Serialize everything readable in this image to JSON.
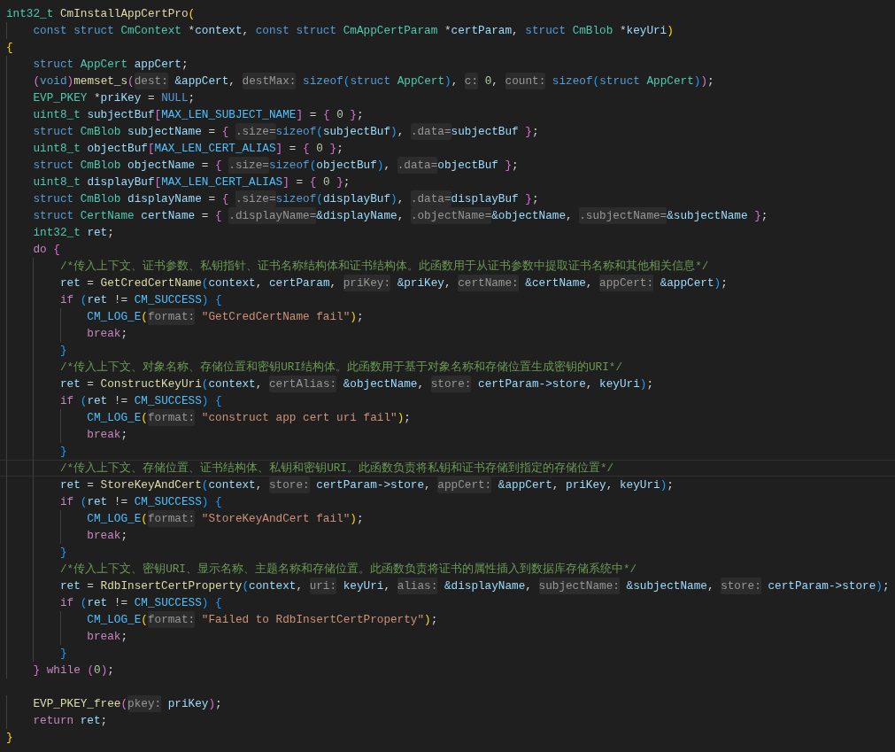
{
  "editor": {
    "lines": [
      {
        "current": false,
        "tokens": [
          {
            "kind": "type",
            "text": "int32_t "
          },
          {
            "kind": "function",
            "text": "CmInstallAppCertPro"
          },
          {
            "kind": "bracket1",
            "text": "("
          }
        ]
      },
      {
        "current": false,
        "tokens": [
          {
            "kind": "keyword",
            "text": "    const struct "
          },
          {
            "kind": "type",
            "text": "CmContext "
          },
          {
            "kind": "punct",
            "text": "*"
          },
          {
            "kind": "variable",
            "text": "context"
          },
          {
            "kind": "punct",
            "text": ", "
          },
          {
            "kind": "keyword",
            "text": "const struct "
          },
          {
            "kind": "type",
            "text": "CmAppCertParam "
          },
          {
            "kind": "punct",
            "text": "*"
          },
          {
            "kind": "variable",
            "text": "certParam"
          },
          {
            "kind": "punct",
            "text": ", "
          },
          {
            "kind": "keyword",
            "text": "struct "
          },
          {
            "kind": "type",
            "text": "CmBlob "
          },
          {
            "kind": "punct",
            "text": "*"
          },
          {
            "kind": "variable",
            "text": "keyUri"
          },
          {
            "kind": "bracket1",
            "text": ")"
          }
        ]
      },
      {
        "current": false,
        "tokens": [
          {
            "kind": "bracket1",
            "text": "{"
          }
        ]
      },
      {
        "current": false,
        "tokens": [
          {
            "kind": "keyword",
            "text": "    struct "
          },
          {
            "kind": "type",
            "text": "AppCert "
          },
          {
            "kind": "variable",
            "text": "appCert"
          },
          {
            "kind": "punct",
            "text": ";"
          }
        ]
      },
      {
        "current": false,
        "tokens": [
          {
            "kind": "bracket2",
            "text": "    ("
          },
          {
            "kind": "keyword",
            "text": "void"
          },
          {
            "kind": "bracket2",
            "text": ")"
          },
          {
            "kind": "function",
            "text": "memset_s"
          },
          {
            "kind": "bracket2",
            "text": "("
          },
          {
            "kind": "hint",
            "text": "dest:"
          },
          {
            "kind": "variable",
            "text": " &appCert"
          },
          {
            "kind": "punct",
            "text": ", "
          },
          {
            "kind": "hint",
            "text": "destMax:"
          },
          {
            "kind": "keyword",
            "text": " sizeof"
          },
          {
            "kind": "bracket3",
            "text": "("
          },
          {
            "kind": "keyword",
            "text": "struct "
          },
          {
            "kind": "type",
            "text": "AppCert"
          },
          {
            "kind": "bracket3",
            "text": ")"
          },
          {
            "kind": "punct",
            "text": ", "
          },
          {
            "kind": "hint",
            "text": "c:"
          },
          {
            "kind": "number",
            "text": " 0"
          },
          {
            "kind": "punct",
            "text": ", "
          },
          {
            "kind": "hint",
            "text": "count:"
          },
          {
            "kind": "keyword",
            "text": " sizeof"
          },
          {
            "kind": "bracket3",
            "text": "("
          },
          {
            "kind": "keyword",
            "text": "struct "
          },
          {
            "kind": "type",
            "text": "AppCert"
          },
          {
            "kind": "bracket3",
            "text": ")"
          },
          {
            "kind": "bracket2",
            "text": ")"
          },
          {
            "kind": "punct",
            "text": ";"
          }
        ]
      },
      {
        "current": false,
        "tokens": [
          {
            "kind": "type",
            "text": "    EVP_PKEY "
          },
          {
            "kind": "punct",
            "text": "*"
          },
          {
            "kind": "variable",
            "text": "priKey"
          },
          {
            "kind": "punct",
            "text": " = "
          },
          {
            "kind": "keyword",
            "text": "NULL"
          },
          {
            "kind": "punct",
            "text": ";"
          }
        ]
      },
      {
        "current": false,
        "tokens": [
          {
            "kind": "type",
            "text": "    uint8_t "
          },
          {
            "kind": "variable",
            "text": "subjectBuf"
          },
          {
            "kind": "bracket2",
            "text": "["
          },
          {
            "kind": "macro",
            "text": "MAX_LEN_SUBJECT_NAME"
          },
          {
            "kind": "bracket2",
            "text": "]"
          },
          {
            "kind": "punct",
            "text": " = "
          },
          {
            "kind": "bracket2",
            "text": "{ "
          },
          {
            "kind": "number",
            "text": "0"
          },
          {
            "kind": "bracket2",
            "text": " }"
          },
          {
            "kind": "punct",
            "text": ";"
          }
        ]
      },
      {
        "current": false,
        "tokens": [
          {
            "kind": "keyword",
            "text": "    struct "
          },
          {
            "kind": "type",
            "text": "CmBlob "
          },
          {
            "kind": "variable",
            "text": "subjectName"
          },
          {
            "kind": "punct",
            "text": " = "
          },
          {
            "kind": "bracket2",
            "text": "{ "
          },
          {
            "kind": "hint",
            "text": ".size="
          },
          {
            "kind": "keyword",
            "text": "sizeof"
          },
          {
            "kind": "bracket3",
            "text": "("
          },
          {
            "kind": "variable",
            "text": "subjectBuf"
          },
          {
            "kind": "bracket3",
            "text": ")"
          },
          {
            "kind": "punct",
            "text": ", "
          },
          {
            "kind": "hint",
            "text": ".data="
          },
          {
            "kind": "variable",
            "text": "subjectBuf"
          },
          {
            "kind": "bracket2",
            "text": " }"
          },
          {
            "kind": "punct",
            "text": ";"
          }
        ]
      },
      {
        "current": false,
        "tokens": [
          {
            "kind": "type",
            "text": "    uint8_t "
          },
          {
            "kind": "variable",
            "text": "objectBuf"
          },
          {
            "kind": "bracket2",
            "text": "["
          },
          {
            "kind": "macro",
            "text": "MAX_LEN_CERT_ALIAS"
          },
          {
            "kind": "bracket2",
            "text": "]"
          },
          {
            "kind": "punct",
            "text": " = "
          },
          {
            "kind": "bracket2",
            "text": "{ "
          },
          {
            "kind": "number",
            "text": "0"
          },
          {
            "kind": "bracket2",
            "text": " }"
          },
          {
            "kind": "punct",
            "text": ";"
          }
        ]
      },
      {
        "current": false,
        "tokens": [
          {
            "kind": "keyword",
            "text": "    struct "
          },
          {
            "kind": "type",
            "text": "CmBlob "
          },
          {
            "kind": "variable",
            "text": "objectName"
          },
          {
            "kind": "punct",
            "text": " = "
          },
          {
            "kind": "bracket2",
            "text": "{ "
          },
          {
            "kind": "hint",
            "text": ".size="
          },
          {
            "kind": "keyword",
            "text": "sizeof"
          },
          {
            "kind": "bracket3",
            "text": "("
          },
          {
            "kind": "variable",
            "text": "objectBuf"
          },
          {
            "kind": "bracket3",
            "text": ")"
          },
          {
            "kind": "punct",
            "text": ", "
          },
          {
            "kind": "hint",
            "text": ".data="
          },
          {
            "kind": "variable",
            "text": "objectBuf"
          },
          {
            "kind": "bracket2",
            "text": " }"
          },
          {
            "kind": "punct",
            "text": ";"
          }
        ]
      },
      {
        "current": false,
        "tokens": [
          {
            "kind": "type",
            "text": "    uint8_t "
          },
          {
            "kind": "variable",
            "text": "displayBuf"
          },
          {
            "kind": "bracket2",
            "text": "["
          },
          {
            "kind": "macro",
            "text": "MAX_LEN_CERT_ALIAS"
          },
          {
            "kind": "bracket2",
            "text": "]"
          },
          {
            "kind": "punct",
            "text": " = "
          },
          {
            "kind": "bracket2",
            "text": "{ "
          },
          {
            "kind": "number",
            "text": "0"
          },
          {
            "kind": "bracket2",
            "text": " }"
          },
          {
            "kind": "punct",
            "text": ";"
          }
        ]
      },
      {
        "current": false,
        "tokens": [
          {
            "kind": "keyword",
            "text": "    struct "
          },
          {
            "kind": "type",
            "text": "CmBlob "
          },
          {
            "kind": "variable",
            "text": "displayName"
          },
          {
            "kind": "punct",
            "text": " = "
          },
          {
            "kind": "bracket2",
            "text": "{ "
          },
          {
            "kind": "hint",
            "text": ".size="
          },
          {
            "kind": "keyword",
            "text": "sizeof"
          },
          {
            "kind": "bracket3",
            "text": "("
          },
          {
            "kind": "variable",
            "text": "displayBuf"
          },
          {
            "kind": "bracket3",
            "text": ")"
          },
          {
            "kind": "punct",
            "text": ", "
          },
          {
            "kind": "hint",
            "text": ".data="
          },
          {
            "kind": "variable",
            "text": "displayBuf"
          },
          {
            "kind": "bracket2",
            "text": " }"
          },
          {
            "kind": "punct",
            "text": ";"
          }
        ]
      },
      {
        "current": false,
        "tokens": [
          {
            "kind": "keyword",
            "text": "    struct "
          },
          {
            "kind": "type",
            "text": "CertName "
          },
          {
            "kind": "variable",
            "text": "certName"
          },
          {
            "kind": "punct",
            "text": " = "
          },
          {
            "kind": "bracket2",
            "text": "{ "
          },
          {
            "kind": "hint",
            "text": ".displayName="
          },
          {
            "kind": "variable",
            "text": "&displayName"
          },
          {
            "kind": "punct",
            "text": ", "
          },
          {
            "kind": "hint",
            "text": ".objectName="
          },
          {
            "kind": "variable",
            "text": "&objectName"
          },
          {
            "kind": "punct",
            "text": ", "
          },
          {
            "kind": "hint",
            "text": ".subjectName="
          },
          {
            "kind": "variable",
            "text": "&subjectName"
          },
          {
            "kind": "bracket2",
            "text": " }"
          },
          {
            "kind": "punct",
            "text": ";"
          }
        ]
      },
      {
        "current": false,
        "tokens": [
          {
            "kind": "type",
            "text": "    int32_t "
          },
          {
            "kind": "variable",
            "text": "ret"
          },
          {
            "kind": "punct",
            "text": ";"
          }
        ]
      },
      {
        "current": false,
        "tokens": [
          {
            "kind": "control",
            "text": "    do "
          },
          {
            "kind": "bracket2",
            "text": "{"
          }
        ]
      },
      {
        "current": false,
        "tokens": [
          {
            "kind": "comment",
            "text": "        /*传入上下文、证书参数、私钥指针、证书名称结构体和证书结构体。此函数用于从证书参数中提取证书名称和其他相关信息*/"
          }
        ]
      },
      {
        "current": false,
        "tokens": [
          {
            "kind": "variable",
            "text": "        ret"
          },
          {
            "kind": "punct",
            "text": " = "
          },
          {
            "kind": "function",
            "text": "GetCredCertName"
          },
          {
            "kind": "bracket3",
            "text": "("
          },
          {
            "kind": "variable",
            "text": "context"
          },
          {
            "kind": "punct",
            "text": ", "
          },
          {
            "kind": "variable",
            "text": "certParam"
          },
          {
            "kind": "punct",
            "text": ", "
          },
          {
            "kind": "hint",
            "text": "priKey:"
          },
          {
            "kind": "variable",
            "text": " &priKey"
          },
          {
            "kind": "punct",
            "text": ", "
          },
          {
            "kind": "hint",
            "text": "certName:"
          },
          {
            "kind": "variable",
            "text": " &certName"
          },
          {
            "kind": "punct",
            "text": ", "
          },
          {
            "kind": "hint",
            "text": "appCert:"
          },
          {
            "kind": "variable",
            "text": " &appCert"
          },
          {
            "kind": "bracket3",
            "text": ")"
          },
          {
            "kind": "punct",
            "text": ";"
          }
        ]
      },
      {
        "current": false,
        "tokens": [
          {
            "kind": "control",
            "text": "        if "
          },
          {
            "kind": "bracket3",
            "text": "("
          },
          {
            "kind": "variable",
            "text": "ret"
          },
          {
            "kind": "punct",
            "text": " != "
          },
          {
            "kind": "macro",
            "text": "CM_SUCCESS"
          },
          {
            "kind": "bracket3",
            "text": ")"
          },
          {
            "kind": "bracket3",
            "text": " {"
          }
        ]
      },
      {
        "current": false,
        "tokens": [
          {
            "kind": "macro",
            "text": "            CM_LOG_E"
          },
          {
            "kind": "bracket1",
            "text": "("
          },
          {
            "kind": "hint",
            "text": "format:"
          },
          {
            "kind": "string",
            "text": " \"GetCredCertName fail\""
          },
          {
            "kind": "bracket1",
            "text": ")"
          },
          {
            "kind": "punct",
            "text": ";"
          }
        ]
      },
      {
        "current": false,
        "tokens": [
          {
            "kind": "control",
            "text": "            break"
          },
          {
            "kind": "punct",
            "text": ";"
          }
        ]
      },
      {
        "current": false,
        "tokens": [
          {
            "kind": "bracket3",
            "text": "        }"
          }
        ]
      },
      {
        "current": false,
        "tokens": [
          {
            "kind": "comment",
            "text": "        /*传入上下文、对象名称、存储位置和密钥URI结构体。此函数用于基于对象名称和存储位置生成密钥的URI*/"
          }
        ]
      },
      {
        "current": false,
        "tokens": [
          {
            "kind": "variable",
            "text": "        ret"
          },
          {
            "kind": "punct",
            "text": " = "
          },
          {
            "kind": "function",
            "text": "ConstructKeyUri"
          },
          {
            "kind": "bracket3",
            "text": "("
          },
          {
            "kind": "variable",
            "text": "context"
          },
          {
            "kind": "punct",
            "text": ", "
          },
          {
            "kind": "hint",
            "text": "certAlias:"
          },
          {
            "kind": "variable",
            "text": " &objectName"
          },
          {
            "kind": "punct",
            "text": ", "
          },
          {
            "kind": "hint",
            "text": "store:"
          },
          {
            "kind": "variable",
            "text": " certParam->store"
          },
          {
            "kind": "punct",
            "text": ", "
          },
          {
            "kind": "variable",
            "text": "keyUri"
          },
          {
            "kind": "bracket3",
            "text": ")"
          },
          {
            "kind": "punct",
            "text": ";"
          }
        ]
      },
      {
        "current": false,
        "tokens": [
          {
            "kind": "control",
            "text": "        if "
          },
          {
            "kind": "bracket3",
            "text": "("
          },
          {
            "kind": "variable",
            "text": "ret"
          },
          {
            "kind": "punct",
            "text": " != "
          },
          {
            "kind": "macro",
            "text": "CM_SUCCESS"
          },
          {
            "kind": "bracket3",
            "text": ")"
          },
          {
            "kind": "bracket3",
            "text": " {"
          }
        ]
      },
      {
        "current": false,
        "tokens": [
          {
            "kind": "macro",
            "text": "            CM_LOG_E"
          },
          {
            "kind": "bracket1",
            "text": "("
          },
          {
            "kind": "hint",
            "text": "format:"
          },
          {
            "kind": "string",
            "text": " \"construct app cert uri fail\""
          },
          {
            "kind": "bracket1",
            "text": ")"
          },
          {
            "kind": "punct",
            "text": ";"
          }
        ]
      },
      {
        "current": false,
        "tokens": [
          {
            "kind": "control",
            "text": "            break"
          },
          {
            "kind": "punct",
            "text": ";"
          }
        ]
      },
      {
        "current": false,
        "tokens": [
          {
            "kind": "bracket3",
            "text": "        }"
          }
        ]
      },
      {
        "current": true,
        "tokens": [
          {
            "kind": "comment",
            "text": "        /*传入上下文、存储位置、证书结构体、私钥和密钥URI。此函数负责将私钥和证书存储到指定的存储位置*/"
          }
        ]
      },
      {
        "current": false,
        "tokens": [
          {
            "kind": "variable",
            "text": "        ret"
          },
          {
            "kind": "punct",
            "text": " = "
          },
          {
            "kind": "function",
            "text": "StoreKeyAndCert"
          },
          {
            "kind": "bracket3",
            "text": "("
          },
          {
            "kind": "variable",
            "text": "context"
          },
          {
            "kind": "punct",
            "text": ", "
          },
          {
            "kind": "hint",
            "text": "store:"
          },
          {
            "kind": "variable",
            "text": " certParam->store"
          },
          {
            "kind": "punct",
            "text": ", "
          },
          {
            "kind": "hint",
            "text": "appCert:"
          },
          {
            "kind": "variable",
            "text": " &appCert"
          },
          {
            "kind": "punct",
            "text": ", "
          },
          {
            "kind": "variable",
            "text": "priKey"
          },
          {
            "kind": "punct",
            "text": ", "
          },
          {
            "kind": "variable",
            "text": "keyUri"
          },
          {
            "kind": "bracket3",
            "text": ")"
          },
          {
            "kind": "punct",
            "text": ";"
          }
        ]
      },
      {
        "current": false,
        "tokens": [
          {
            "kind": "control",
            "text": "        if "
          },
          {
            "kind": "bracket3",
            "text": "("
          },
          {
            "kind": "variable",
            "text": "ret"
          },
          {
            "kind": "punct",
            "text": " != "
          },
          {
            "kind": "macro",
            "text": "CM_SUCCESS"
          },
          {
            "kind": "bracket3",
            "text": ")"
          },
          {
            "kind": "bracket3",
            "text": " {"
          }
        ]
      },
      {
        "current": false,
        "tokens": [
          {
            "kind": "macro",
            "text": "            CM_LOG_E"
          },
          {
            "kind": "bracket1",
            "text": "("
          },
          {
            "kind": "hint",
            "text": "format:"
          },
          {
            "kind": "string",
            "text": " \"StoreKeyAndCert fail\""
          },
          {
            "kind": "bracket1",
            "text": ")"
          },
          {
            "kind": "punct",
            "text": ";"
          }
        ]
      },
      {
        "current": false,
        "tokens": [
          {
            "kind": "control",
            "text": "            break"
          },
          {
            "kind": "punct",
            "text": ";"
          }
        ]
      },
      {
        "current": false,
        "tokens": [
          {
            "kind": "bracket3",
            "text": "        }"
          }
        ]
      },
      {
        "current": false,
        "tokens": [
          {
            "kind": "comment",
            "text": "        /*传入上下文、密钥URI、显示名称、主题名称和存储位置。此函数负责将证书的属性插入到数据库存储系统中*/"
          }
        ]
      },
      {
        "current": false,
        "tokens": [
          {
            "kind": "variable",
            "text": "        ret"
          },
          {
            "kind": "punct",
            "text": " = "
          },
          {
            "kind": "function",
            "text": "RdbInsertCertProperty"
          },
          {
            "kind": "bracket3",
            "text": "("
          },
          {
            "kind": "variable",
            "text": "context"
          },
          {
            "kind": "punct",
            "text": ", "
          },
          {
            "kind": "hint",
            "text": "uri:"
          },
          {
            "kind": "variable",
            "text": " keyUri"
          },
          {
            "kind": "punct",
            "text": ", "
          },
          {
            "kind": "hint",
            "text": "alias:"
          },
          {
            "kind": "variable",
            "text": " &displayName"
          },
          {
            "kind": "punct",
            "text": ", "
          },
          {
            "kind": "hint",
            "text": "subjectName:"
          },
          {
            "kind": "variable",
            "text": " &subjectName"
          },
          {
            "kind": "punct",
            "text": ", "
          },
          {
            "kind": "hint",
            "text": "store:"
          },
          {
            "kind": "variable",
            "text": " certParam->store"
          },
          {
            "kind": "bracket3",
            "text": ")"
          },
          {
            "kind": "punct",
            "text": ";"
          }
        ]
      },
      {
        "current": false,
        "tokens": [
          {
            "kind": "control",
            "text": "        if "
          },
          {
            "kind": "bracket3",
            "text": "("
          },
          {
            "kind": "variable",
            "text": "ret"
          },
          {
            "kind": "punct",
            "text": " != "
          },
          {
            "kind": "macro",
            "text": "CM_SUCCESS"
          },
          {
            "kind": "bracket3",
            "text": ")"
          },
          {
            "kind": "bracket3",
            "text": " {"
          }
        ]
      },
      {
        "current": false,
        "tokens": [
          {
            "kind": "macro",
            "text": "            CM_LOG_E"
          },
          {
            "kind": "bracket1",
            "text": "("
          },
          {
            "kind": "hint",
            "text": "format:"
          },
          {
            "kind": "string",
            "text": " \"Failed to RdbInsertCertProperty\""
          },
          {
            "kind": "bracket1",
            "text": ")"
          },
          {
            "kind": "punct",
            "text": ";"
          }
        ]
      },
      {
        "current": false,
        "tokens": [
          {
            "kind": "control",
            "text": "            break"
          },
          {
            "kind": "punct",
            "text": ";"
          }
        ]
      },
      {
        "current": false,
        "tokens": [
          {
            "kind": "bracket3",
            "text": "        }"
          }
        ]
      },
      {
        "current": false,
        "tokens": [
          {
            "kind": "bracket2",
            "text": "    }"
          },
          {
            "kind": "control",
            "text": " while "
          },
          {
            "kind": "bracket2",
            "text": "("
          },
          {
            "kind": "number",
            "text": "0"
          },
          {
            "kind": "bracket2",
            "text": ")"
          },
          {
            "kind": "punct",
            "text": ";"
          }
        ]
      },
      {
        "current": false
      },
      {
        "current": false,
        "tokens": [
          {
            "kind": "function",
            "text": "    EVP_PKEY_free"
          },
          {
            "kind": "bracket2",
            "text": "("
          },
          {
            "kind": "hint",
            "text": "pkey:"
          },
          {
            "kind": "variable",
            "text": " priKey"
          },
          {
            "kind": "bracket2",
            "text": ")"
          },
          {
            "kind": "punct",
            "text": ";"
          }
        ]
      },
      {
        "current": false,
        "tokens": [
          {
            "kind": "control",
            "text": "    return "
          },
          {
            "kind": "variable",
            "text": "ret"
          },
          {
            "kind": "punct",
            "text": ";"
          }
        ]
      },
      {
        "current": false,
        "tokens": [
          {
            "kind": "bracket1",
            "text": "}"
          }
        ]
      }
    ]
  }
}
